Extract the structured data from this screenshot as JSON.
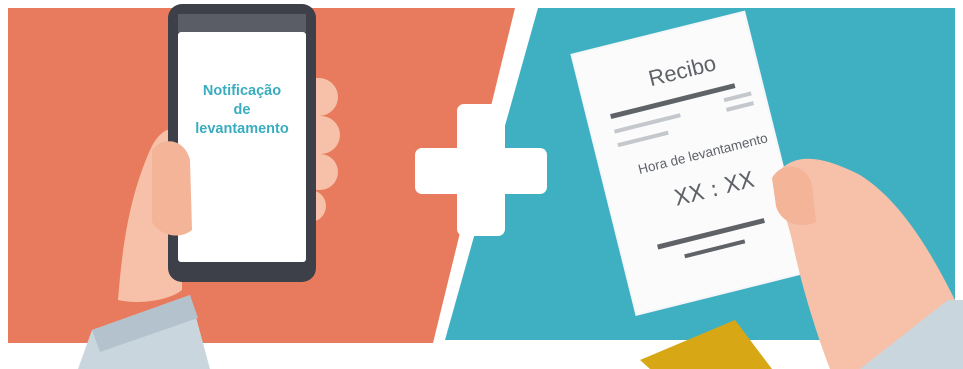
{
  "phone": {
    "notification_lines": [
      "Notificação",
      "de",
      "levantamento"
    ]
  },
  "receipt": {
    "title": "Recibo",
    "label": "Hora de levantamento",
    "time": "XX : XX"
  },
  "colors": {
    "left_panel": "#e87b5d",
    "right_panel": "#3eb0c1",
    "accent_text": "#3aacbf",
    "plus": "#ffffff",
    "ticket": "#d7a716"
  }
}
